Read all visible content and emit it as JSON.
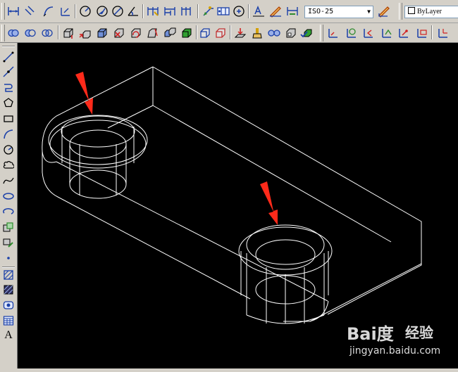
{
  "toolbar": {
    "dimension_style": "ISO-25",
    "layer_color": "ByLayer"
  },
  "watermark": {
    "brand_text": "Bai度",
    "jingyan_text": "经验",
    "url": "jingyan.baidu.com"
  },
  "left_toolbar": {
    "text_tool_glyph": "A"
  },
  "colors": {
    "canvas_bg": "#000000",
    "wireframe": "#ffffff",
    "arrow": "#ff2a1a",
    "toolbar_bg": "#d4d0c8",
    "icon_blue": "#1a3fa8",
    "icon_green": "#2e8b2e"
  }
}
